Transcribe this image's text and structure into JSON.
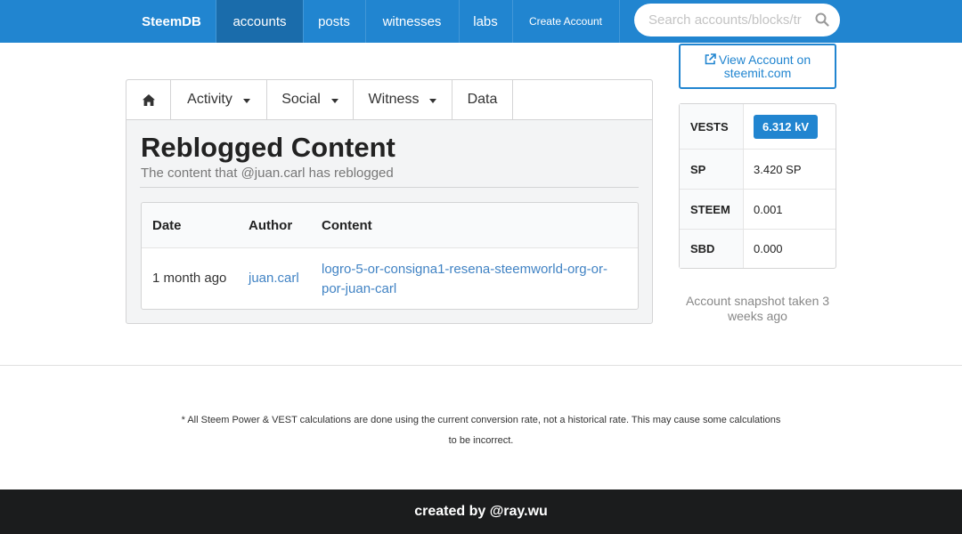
{
  "navbar": {
    "brand": "SteemDB",
    "items": [
      {
        "label": "accounts",
        "active": true
      },
      {
        "label": "posts"
      },
      {
        "label": "witnesses"
      },
      {
        "label": "labs"
      },
      {
        "label": "Create Account"
      }
    ],
    "search_placeholder": "Search accounts/blocks/tr",
    "search_icon": "search-icon",
    "color": "#2185d0"
  },
  "tabs": [
    {
      "icon": "home-icon"
    },
    {
      "label": "Activity",
      "dropdown": true
    },
    {
      "label": "Social",
      "dropdown": true
    },
    {
      "label": "Witness",
      "dropdown": true
    },
    {
      "label": "Data"
    }
  ],
  "main": {
    "title": "Reblogged Content",
    "subtitle": "The content that @juan.carl has reblogged",
    "table": {
      "headers": [
        "Date",
        "Author",
        "Content"
      ],
      "rows": [
        {
          "date": "1 month ago",
          "author": "juan.carl",
          "content": "logro-5-or-consigna1-resena-steemworld-org-or-por-juan-carl"
        }
      ]
    }
  },
  "sidebar": {
    "view_button": "View Account on steemit.com",
    "view_icon": "external-link-icon",
    "stats": [
      {
        "label": "VESTS",
        "value": "6.312 kV"
      },
      {
        "label": "SP",
        "value": "3.420 SP"
      },
      {
        "label": "STEEM",
        "value": "0.001"
      },
      {
        "label": "SBD",
        "value": "0.000"
      }
    ],
    "snapshot": "Account snapshot taken 3 weeks ago"
  },
  "footer": {
    "disclaimer": "* All Steem Power & VEST calculations are done using the current conversion rate, not a historical rate. This may cause some calculations to be incorrect.",
    "credit": "created by @ray.wu"
  }
}
